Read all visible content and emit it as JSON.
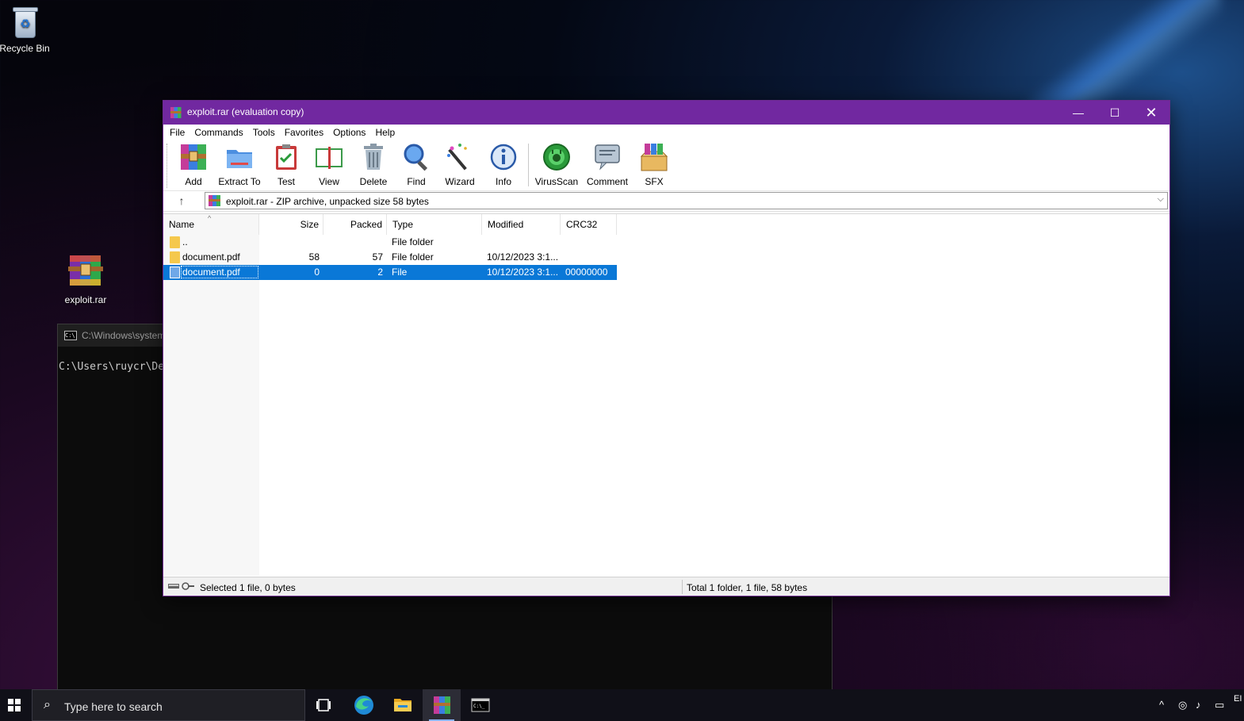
{
  "desktop": {
    "recycle_bin_label": "Recycle Bin",
    "archive_label": "exploit.rar"
  },
  "console": {
    "title": "C:\\Windows\\system",
    "text": "C:\\Users\\ruycr\\De"
  },
  "window": {
    "title": "exploit.rar (evaluation copy)",
    "minimize": "—",
    "maximize": "☐",
    "close": "✕"
  },
  "menu": [
    "File",
    "Commands",
    "Tools",
    "Favorites",
    "Options",
    "Help"
  ],
  "toolbar": {
    "add": "Add",
    "extract_to": "Extract To",
    "test": "Test",
    "view": "View",
    "delete": "Delete",
    "find": "Find",
    "wizard": "Wizard",
    "info": "Info",
    "virusscan": "VirusScan",
    "comment": "Comment",
    "sfx": "SFX"
  },
  "address": {
    "text": "exploit.rar - ZIP archive, unpacked size 58 bytes"
  },
  "columns": {
    "name": "Name",
    "size": "Size",
    "packed": "Packed",
    "type": "Type",
    "modified": "Modified",
    "crc32": "CRC32"
  },
  "rows": [
    {
      "name": "..",
      "size": "",
      "packed": "",
      "type": "File folder",
      "modified": "",
      "crc": ""
    },
    {
      "name": "document.pdf",
      "size": "58",
      "packed": "57",
      "type": "File folder",
      "modified": "10/12/2023 3:1...",
      "crc": ""
    },
    {
      "name": "document.pdf",
      "size": "0",
      "packed": "2",
      "type": "File",
      "modified": "10/12/2023 3:1...",
      "crc": "00000000"
    }
  ],
  "status": {
    "left": "Selected 1 file, 0 bytes",
    "right": "Total 1 folder, 1 file, 58 bytes"
  },
  "taskbar": {
    "search_placeholder": "Type here to search",
    "lang": "EI"
  },
  "colors": {
    "title_bar": "#7128a0",
    "selection": "#0a78d7"
  }
}
